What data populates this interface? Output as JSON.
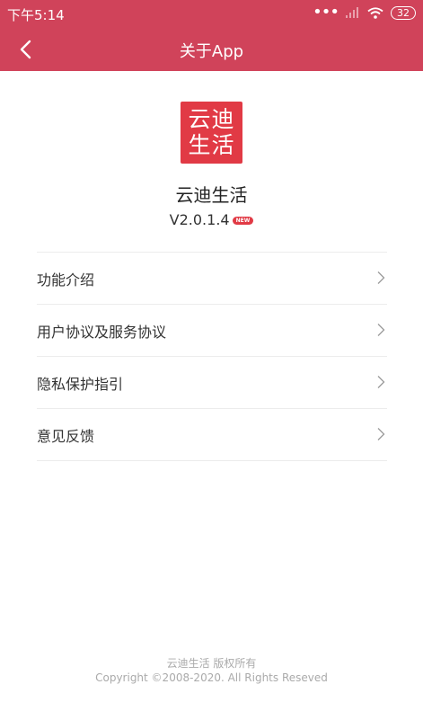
{
  "status_bar": {
    "time": "下午5:14",
    "dots": "•••",
    "battery": "32"
  },
  "navbar": {
    "title": "关于App"
  },
  "app": {
    "logo_line1": "云迪",
    "logo_line2": "生活",
    "name": "云迪生活",
    "version": "V2.0.1.4",
    "badge": "NEW"
  },
  "menu": {
    "items": [
      {
        "label": "功能介绍"
      },
      {
        "label": "用户协议及服务协议"
      },
      {
        "label": "隐私保护指引"
      },
      {
        "label": "意见反馈"
      }
    ]
  },
  "footer": {
    "line1": "云迪生活 版权所有",
    "line2": "Copyright ©2008-2020. All Rights Reseved"
  },
  "colors": {
    "header": "#d0435a",
    "logo": "#e13a45"
  }
}
